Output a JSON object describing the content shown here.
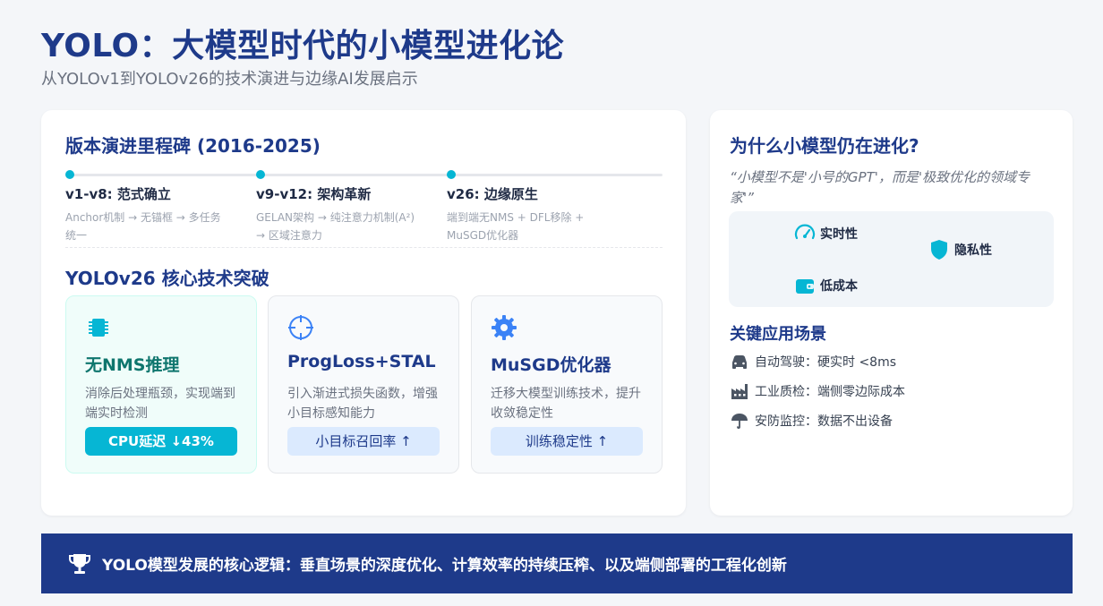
{
  "header": {
    "title": "YOLO：大模型时代的小模型进化论",
    "subtitle": "从YOLOv1到YOLOv26的技术演进与边缘AI发展启示"
  },
  "milestones": {
    "title": "版本演进里程碑 (2016-2025)",
    "items": [
      {
        "title": "v1-v8: 范式确立",
        "desc": "Anchor机制 → 无锚框 → 多任务统一"
      },
      {
        "title": "v9-v12: 架构革新",
        "desc": "GELAN架构 → 纯注意力机制(A²) → 区域注意力"
      },
      {
        "title": "v26: 边缘原生",
        "desc": "端到端无NMS + DFL移除 + MuSGD优化器"
      }
    ]
  },
  "breakthroughs": {
    "title": "YOLOv26 核心技术突破",
    "items": [
      {
        "icon": "chip-icon",
        "name": "无NMS推理",
        "desc": "消除后处理瓶颈，实现端到端实时检测",
        "badge": "CPU延迟 ↓43%"
      },
      {
        "icon": "crosshair-icon",
        "name": "ProgLoss+STAL",
        "desc": "引入渐进式损失函数，增强小目标感知能力",
        "badge": "小目标召回率 ↑"
      },
      {
        "icon": "gear-icon",
        "name": "MuSGD优化器",
        "desc": "迁移大模型训练技术，提升收敛稳定性",
        "badge": "训练稳定性 ↑"
      }
    ]
  },
  "why": {
    "title": "为什么小模型仍在进化?",
    "quote": "“小模型不是'小号的GPT'，而是'极致优化的领域专家'”",
    "properties": [
      {
        "icon": "speedometer-icon",
        "label": "实时性"
      },
      {
        "icon": "shield-icon",
        "label": "隐私性"
      },
      {
        "icon": "wallet-icon",
        "label": "低成本"
      }
    ]
  },
  "applications": {
    "title": "关键应用场景",
    "items": [
      {
        "icon": "car-icon",
        "text": "自动驾驶：硬实时 <8ms"
      },
      {
        "icon": "factory-icon",
        "text": "工业质检：端侧零边际成本"
      },
      {
        "icon": "umbrella-icon",
        "text": "安防监控：数据不出设备"
      }
    ]
  },
  "footer": {
    "icon": "trophy-icon",
    "text": "YOLO模型发展的核心逻辑：垂直场景的深度优化、计算效率的持续压榨、以及端侧部署的工程化创新"
  },
  "colors": {
    "primary": "#1e3a8a",
    "accent": "#06b6d4",
    "background": "#f4f6f9"
  }
}
